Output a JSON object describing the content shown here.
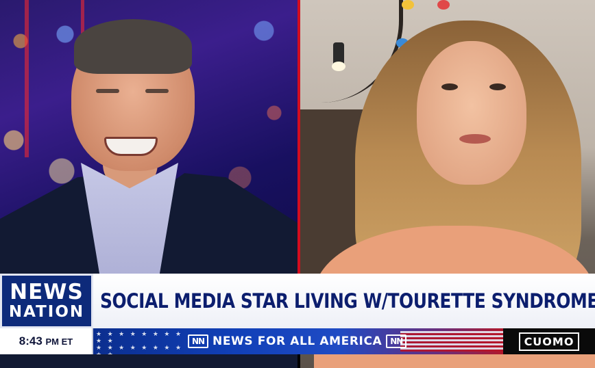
{
  "broadcast": {
    "logo": {
      "line1": "NEWS",
      "line2": "NATION"
    },
    "headline": "SOCIAL MEDIA STAR LIVING W/TOURETTE SYNDROME",
    "time": {
      "clock": "8:43",
      "meridiem": "PM ET"
    },
    "ticker": {
      "text": "NEWS FOR ALL AMERICA",
      "nn_left": "NN",
      "nn_right": "NN"
    },
    "show_name": "CUOMO"
  },
  "colors": {
    "brand_blue": "#0d2a7a",
    "headline_text": "#0c1e6e",
    "divider_red": "#d40d1f"
  }
}
